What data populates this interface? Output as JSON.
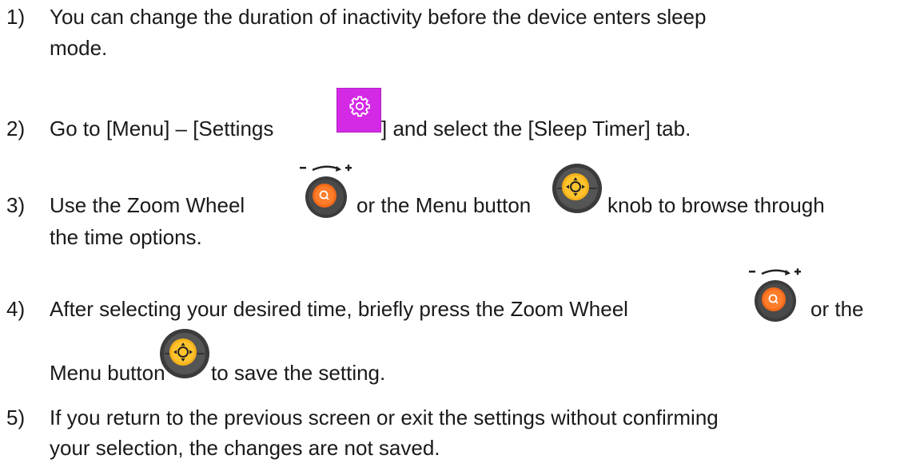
{
  "steps": [
    {
      "num": "1)",
      "line1": "You can change the duration of inactivity before the device enters sleep",
      "line2": "mode."
    },
    {
      "num": "2)",
      "pre": "Go to [Menu] – [Settings",
      "post": "] and select the [Sleep Timer] tab."
    },
    {
      "num": "3)",
      "pre": "Use the Zoom Wheel",
      "mid": "or the Menu button",
      "post": "knob to browse through",
      "line2": "the time options."
    },
    {
      "num": "4)",
      "pre": "After selecting your desired time, briefly press the Zoom Wheel",
      "post": "or the",
      "line2_pre": "Menu button",
      "line2_post": "to save the setting."
    },
    {
      "num": "5)",
      "line1": "If you return to the previous screen or exit the settings without confirming",
      "line2": "your selection, the changes are not saved."
    }
  ],
  "icons": {
    "settings": "gear-icon",
    "zoom_wheel": "zoom-wheel-icon",
    "menu_knob": "menu-knob-icon"
  },
  "colors": {
    "settings_bg": "#d42ae6",
    "wheel_orange": "#f26a1b",
    "knob_yellow": "#f5b21a",
    "dark_body": "#3a3a3a"
  }
}
